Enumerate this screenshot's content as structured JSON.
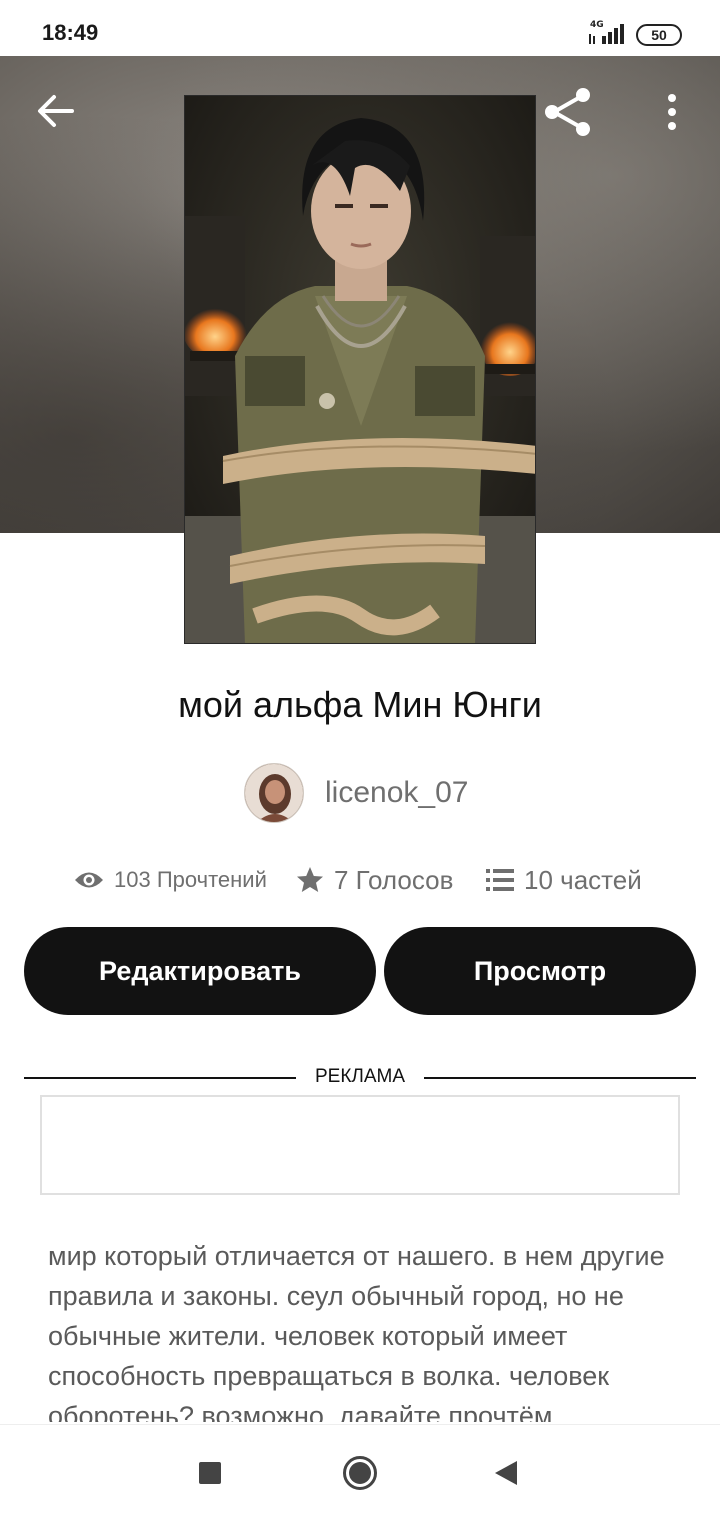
{
  "status_bar": {
    "time": "18:49",
    "network": "4G",
    "battery": "50"
  },
  "header": {
    "back_icon": "arrow-left-icon",
    "share_icon": "share-icon",
    "more_icon": "more-vertical-icon"
  },
  "story": {
    "title": "мой альфа Мин Юнги",
    "author": "licenok_07",
    "stats": {
      "reads": "103 Прочтений",
      "votes": "7 Голосов",
      "parts": "10 частей"
    },
    "description": "мир который отличается от нашего. в нем другие правила и законы. сеул обычный город, но не обычные жители. человек который имеет способность превращаться в волка. человек оборотень? возможно. давайте прочтём"
  },
  "actions": {
    "edit_label": "Редактировать",
    "view_label": "Просмотр"
  },
  "ad": {
    "label": "РЕКЛАМА"
  },
  "nav": {
    "recents_icon": "square-icon",
    "home_icon": "circle-icon",
    "back_icon": "triangle-back-icon"
  },
  "colors": {
    "primary_button": "#121212",
    "text_secondary": "#6f6f6f",
    "hero_background": "#5e5954"
  }
}
